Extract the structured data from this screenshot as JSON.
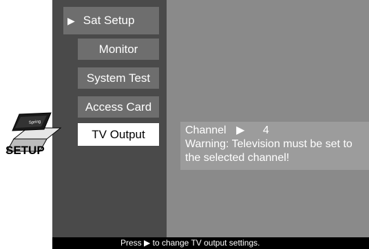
{
  "menu": {
    "items": [
      {
        "label": "Sat Setup",
        "arrow": "▶"
      },
      {
        "label": "Monitor"
      },
      {
        "label": "System Test"
      },
      {
        "label": "Access Card"
      },
      {
        "label": "TV Output"
      }
    ],
    "selected": "TV Output"
  },
  "logo": {
    "text": "SETUP",
    "box_label": "Spring"
  },
  "info": {
    "channel_label": "Channel",
    "channel_arrow": "▶",
    "channel_value": "4",
    "warning": "Warning: Television must be set to the selected channel!"
  },
  "status": {
    "prefix": "Press",
    "arrow": "▶",
    "suffix": "to change TV output settings."
  },
  "colors": {
    "menu_bg": "#4a4a4a",
    "content_bg": "#8a8a8a",
    "button_bg": "#6e6e6e",
    "selected_bg": "#ffffff",
    "status_bg": "#000000"
  }
}
